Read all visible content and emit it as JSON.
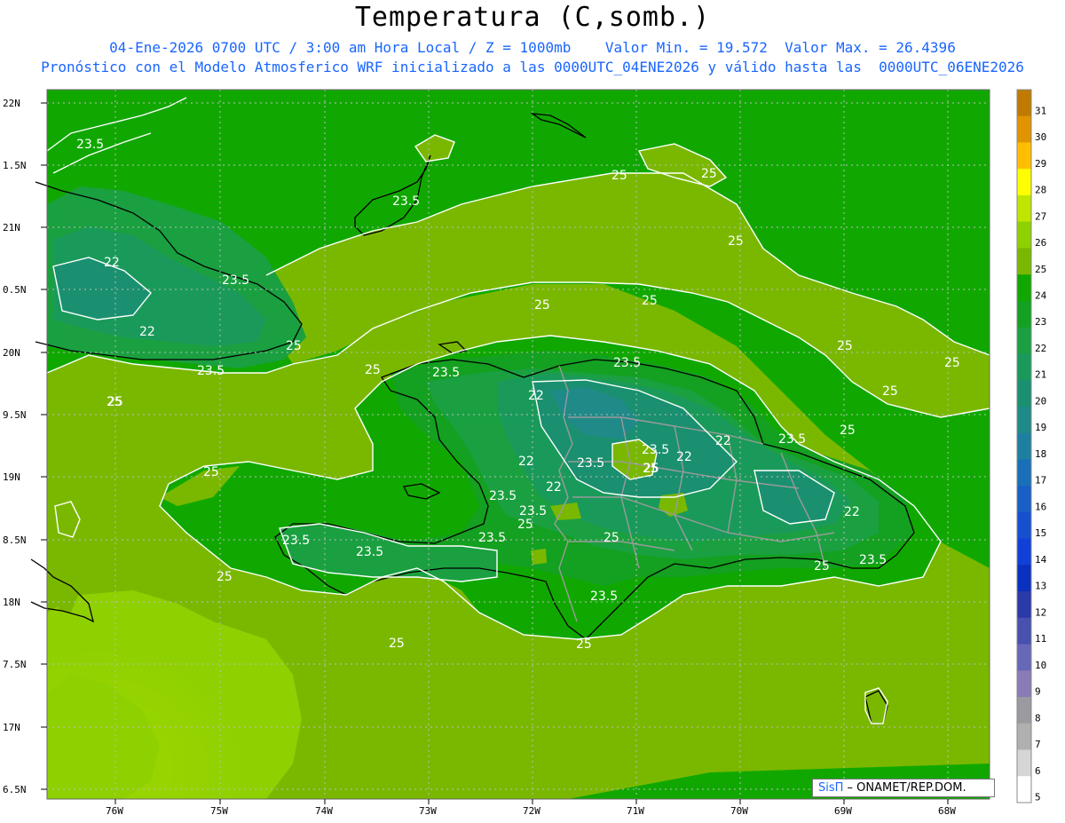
{
  "header": {
    "title": "Temperatura (C,somb.)",
    "subtitle1": "04-Ene-2026 0700 UTC / 3:00 am Hora Local / Z = 1000mb    Valor Min. = 19.572  Valor Max. = 26.4396",
    "subtitle2": "Pronóstico con el Modelo Atmosferico WRF inicializado a las 0000UTC_04ENE2026 y válido hasta las  0000UTC_06ENE2026"
  },
  "axes": {
    "lat_labels": [
      "22N",
      "1.5N",
      "21N",
      "0.5N",
      "20N",
      "9.5N",
      "19N",
      "8.5N",
      "18N",
      "7.5N",
      "17N",
      "6.5N"
    ],
    "lon_labels": [
      "76W",
      "75W",
      "74W",
      "73W",
      "72W",
      "71W",
      "70W",
      "69W",
      "68W"
    ]
  },
  "colorbar": {
    "labels": [
      "31",
      "30",
      "29",
      "28",
      "27",
      "26",
      "25",
      "24",
      "23",
      "22",
      "21",
      "20",
      "19",
      "18",
      "17",
      "16",
      "15",
      "14",
      "13",
      "12",
      "11",
      "10",
      "9",
      "8",
      "7",
      "6",
      "5"
    ],
    "colors": [
      "#c07a00",
      "#e09400",
      "#ffbf00",
      "#ffff00",
      "#bfe600",
      "#8fd000",
      "#7ab800",
      "#10a800",
      "#14a020",
      "#1aa040",
      "#1a9a5a",
      "#1a9070",
      "#208a88",
      "#1e80a0",
      "#1a70b8",
      "#1860c8",
      "#1450d0",
      "#1040d8",
      "#0a30c0",
      "#2a3aa8",
      "#4850b0",
      "#6868b8",
      "#8a7ab8",
      "#9a9aa0",
      "#b0b0b0",
      "#d6d6d6",
      "#ffffff"
    ]
  },
  "contour_labels": [
    "23.5",
    "22",
    "23.5",
    "22",
    "23.5",
    "25",
    "25",
    "25",
    "25",
    "25",
    "25",
    "25",
    "25",
    "23.5",
    "22",
    "23.5",
    "23.5",
    "22",
    "22",
    "23.5",
    "25",
    "22",
    "23.5",
    "22",
    "23.5",
    "25",
    "23.5",
    "23.5",
    "23.5",
    "25",
    "23.5",
    "23.5",
    "22",
    "25",
    "23.5",
    "25",
    "25",
    "25",
    "25",
    "25",
    "25",
    "25",
    "25",
    "25",
    "23.5",
    "25"
  ],
  "credit": {
    "brand": "SisΠ",
    "text": " – ONAMET/REP.DOM."
  }
}
